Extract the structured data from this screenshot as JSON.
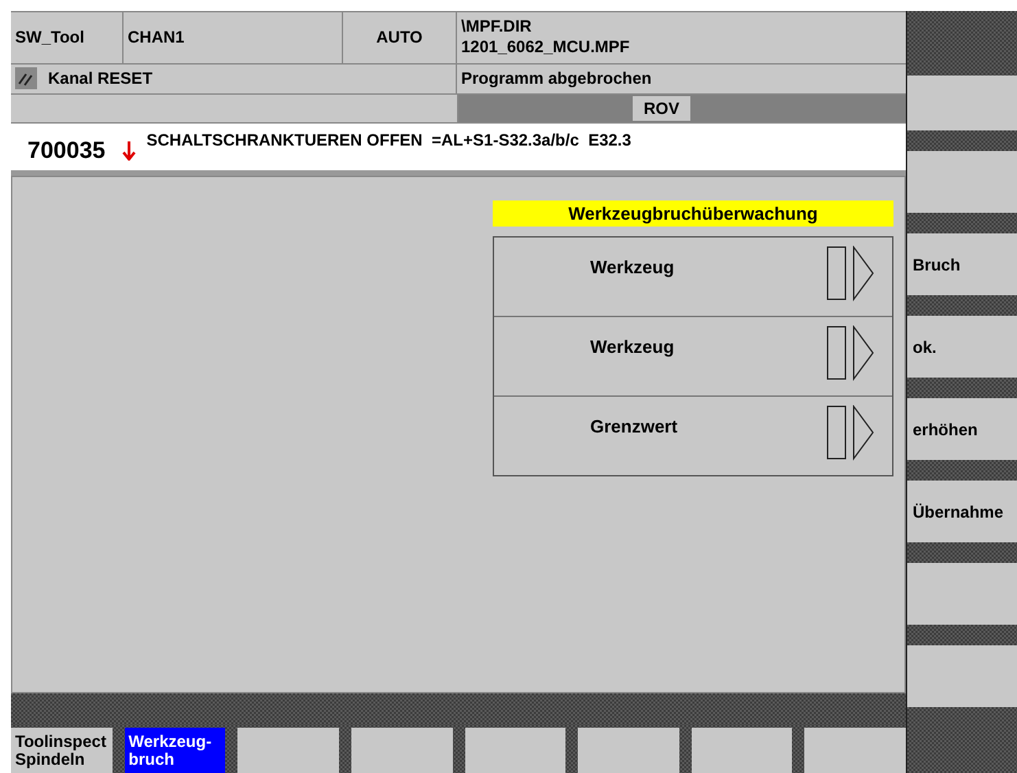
{
  "header": {
    "area": "SW_Tool",
    "channel": "CHAN1",
    "mode": "AUTO",
    "program_path": [
      "\\MPF.DIR",
      "1201_6062_MCU.MPF"
    ],
    "channel_status": "Kanal RESET",
    "program_status": "Programm abgebrochen",
    "override_label": "ROV"
  },
  "alarm": {
    "number": "700035",
    "text": "SCHALTSCHRANKTUEREN OFFEN  =AL+S1-S32.3a/b/c  E32.3"
  },
  "panel": {
    "title": "Werkzeugbruchüberwachung",
    "rows": [
      {
        "label": "Werkzeug"
      },
      {
        "label": "Werkzeug"
      },
      {
        "label": "Grenzwert"
      }
    ]
  },
  "vertical_softkeys": [
    {
      "label": "Bruch"
    },
    {
      "label": "ok."
    },
    {
      "label": "erhöhen"
    },
    {
      "label": "Übernahme"
    }
  ],
  "horizontal_softkeys": [
    {
      "label": "Toolinspect Spindeln",
      "selected": false
    },
    {
      "label": "Werkzeug-bruch",
      "selected": true
    },
    {
      "selected": false
    },
    {
      "selected": false
    },
    {
      "selected": false
    },
    {
      "selected": false
    },
    {
      "selected": false
    },
    {
      "selected": false
    }
  ]
}
